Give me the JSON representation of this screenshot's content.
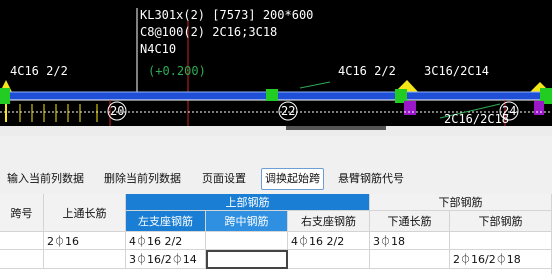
{
  "cad": {
    "beam_title": "KL301x(2) [7573] 200*600",
    "beam_stirrup": "C8@100(2) 2C16;3C18",
    "beam_side": "N4C10",
    "elevation": "(+0.200)",
    "left_support_rebar": "4C16 2/2",
    "mid_support_rebar_a": "4C16 2/2",
    "mid_support_rebar_b": "3C16/2C14",
    "bottom_right_rebar": "2C16/2C18",
    "axis_labels": [
      "20",
      "22",
      "24"
    ],
    "colors": {
      "background": "#000000",
      "beam": "#1e4fd6",
      "text": "#ffffff",
      "annotation": "#2faa55",
      "support": "#f5e617",
      "column": "#22cc22",
      "accent": "#9a18c8"
    }
  },
  "toolbar": {
    "buttons": [
      {
        "label": "输入当前列数据",
        "active": false
      },
      {
        "label": "删除当前列数据",
        "active": false
      },
      {
        "label": "页面设置",
        "active": false
      },
      {
        "label": "调换起始跨",
        "active": true
      },
      {
        "label": "悬臂钢筋代号",
        "active": false
      }
    ]
  },
  "table": {
    "headers": {
      "span_no": "跨号",
      "top_through": "上通长筋",
      "top_group": "上部钢筋",
      "left_support": "左支座钢筋",
      "mid_span": "跨中钢筋",
      "right_support": "右支座钢筋",
      "bottom_group": "下部钢筋",
      "bottom_through": "下通长筋",
      "bottom_rebar": "下部钢筋"
    },
    "rows": [
      {
        "span_no": "",
        "top_through": "2⏀16",
        "left_support": "4⏀16 2/2",
        "mid_span": "",
        "right_support": "4⏀16 2/2",
        "bottom_through": "3⏀18",
        "bottom_rebar": ""
      },
      {
        "span_no": "",
        "top_through": "",
        "left_support": "3⏀16/2⏀14",
        "mid_span": "",
        "right_support": "",
        "bottom_through": "",
        "bottom_rebar": "2⏀16/2⏀18"
      }
    ]
  }
}
